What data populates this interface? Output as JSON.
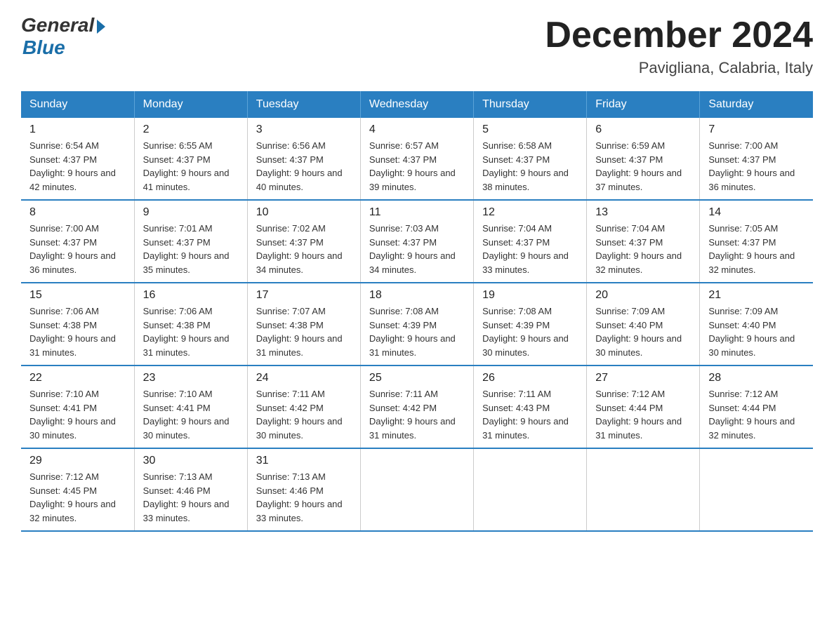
{
  "logo": {
    "general": "General",
    "blue": "Blue"
  },
  "title": "December 2024",
  "location": "Pavigliana, Calabria, Italy",
  "headers": [
    "Sunday",
    "Monday",
    "Tuesday",
    "Wednesday",
    "Thursday",
    "Friday",
    "Saturday"
  ],
  "weeks": [
    [
      {
        "day": "1",
        "sunrise": "6:54 AM",
        "sunset": "4:37 PM",
        "daylight": "9 hours and 42 minutes."
      },
      {
        "day": "2",
        "sunrise": "6:55 AM",
        "sunset": "4:37 PM",
        "daylight": "9 hours and 41 minutes."
      },
      {
        "day": "3",
        "sunrise": "6:56 AM",
        "sunset": "4:37 PM",
        "daylight": "9 hours and 40 minutes."
      },
      {
        "day": "4",
        "sunrise": "6:57 AM",
        "sunset": "4:37 PM",
        "daylight": "9 hours and 39 minutes."
      },
      {
        "day": "5",
        "sunrise": "6:58 AM",
        "sunset": "4:37 PM",
        "daylight": "9 hours and 38 minutes."
      },
      {
        "day": "6",
        "sunrise": "6:59 AM",
        "sunset": "4:37 PM",
        "daylight": "9 hours and 37 minutes."
      },
      {
        "day": "7",
        "sunrise": "7:00 AM",
        "sunset": "4:37 PM",
        "daylight": "9 hours and 36 minutes."
      }
    ],
    [
      {
        "day": "8",
        "sunrise": "7:00 AM",
        "sunset": "4:37 PM",
        "daylight": "9 hours and 36 minutes."
      },
      {
        "day": "9",
        "sunrise": "7:01 AM",
        "sunset": "4:37 PM",
        "daylight": "9 hours and 35 minutes."
      },
      {
        "day": "10",
        "sunrise": "7:02 AM",
        "sunset": "4:37 PM",
        "daylight": "9 hours and 34 minutes."
      },
      {
        "day": "11",
        "sunrise": "7:03 AM",
        "sunset": "4:37 PM",
        "daylight": "9 hours and 34 minutes."
      },
      {
        "day": "12",
        "sunrise": "7:04 AM",
        "sunset": "4:37 PM",
        "daylight": "9 hours and 33 minutes."
      },
      {
        "day": "13",
        "sunrise": "7:04 AM",
        "sunset": "4:37 PM",
        "daylight": "9 hours and 32 minutes."
      },
      {
        "day": "14",
        "sunrise": "7:05 AM",
        "sunset": "4:37 PM",
        "daylight": "9 hours and 32 minutes."
      }
    ],
    [
      {
        "day": "15",
        "sunrise": "7:06 AM",
        "sunset": "4:38 PM",
        "daylight": "9 hours and 31 minutes."
      },
      {
        "day": "16",
        "sunrise": "7:06 AM",
        "sunset": "4:38 PM",
        "daylight": "9 hours and 31 minutes."
      },
      {
        "day": "17",
        "sunrise": "7:07 AM",
        "sunset": "4:38 PM",
        "daylight": "9 hours and 31 minutes."
      },
      {
        "day": "18",
        "sunrise": "7:08 AM",
        "sunset": "4:39 PM",
        "daylight": "9 hours and 31 minutes."
      },
      {
        "day": "19",
        "sunrise": "7:08 AM",
        "sunset": "4:39 PM",
        "daylight": "9 hours and 30 minutes."
      },
      {
        "day": "20",
        "sunrise": "7:09 AM",
        "sunset": "4:40 PM",
        "daylight": "9 hours and 30 minutes."
      },
      {
        "day": "21",
        "sunrise": "7:09 AM",
        "sunset": "4:40 PM",
        "daylight": "9 hours and 30 minutes."
      }
    ],
    [
      {
        "day": "22",
        "sunrise": "7:10 AM",
        "sunset": "4:41 PM",
        "daylight": "9 hours and 30 minutes."
      },
      {
        "day": "23",
        "sunrise": "7:10 AM",
        "sunset": "4:41 PM",
        "daylight": "9 hours and 30 minutes."
      },
      {
        "day": "24",
        "sunrise": "7:11 AM",
        "sunset": "4:42 PM",
        "daylight": "9 hours and 30 minutes."
      },
      {
        "day": "25",
        "sunrise": "7:11 AM",
        "sunset": "4:42 PM",
        "daylight": "9 hours and 31 minutes."
      },
      {
        "day": "26",
        "sunrise": "7:11 AM",
        "sunset": "4:43 PM",
        "daylight": "9 hours and 31 minutes."
      },
      {
        "day": "27",
        "sunrise": "7:12 AM",
        "sunset": "4:44 PM",
        "daylight": "9 hours and 31 minutes."
      },
      {
        "day": "28",
        "sunrise": "7:12 AM",
        "sunset": "4:44 PM",
        "daylight": "9 hours and 32 minutes."
      }
    ],
    [
      {
        "day": "29",
        "sunrise": "7:12 AM",
        "sunset": "4:45 PM",
        "daylight": "9 hours and 32 minutes."
      },
      {
        "day": "30",
        "sunrise": "7:13 AM",
        "sunset": "4:46 PM",
        "daylight": "9 hours and 33 minutes."
      },
      {
        "day": "31",
        "sunrise": "7:13 AM",
        "sunset": "4:46 PM",
        "daylight": "9 hours and 33 minutes."
      },
      null,
      null,
      null,
      null
    ]
  ]
}
